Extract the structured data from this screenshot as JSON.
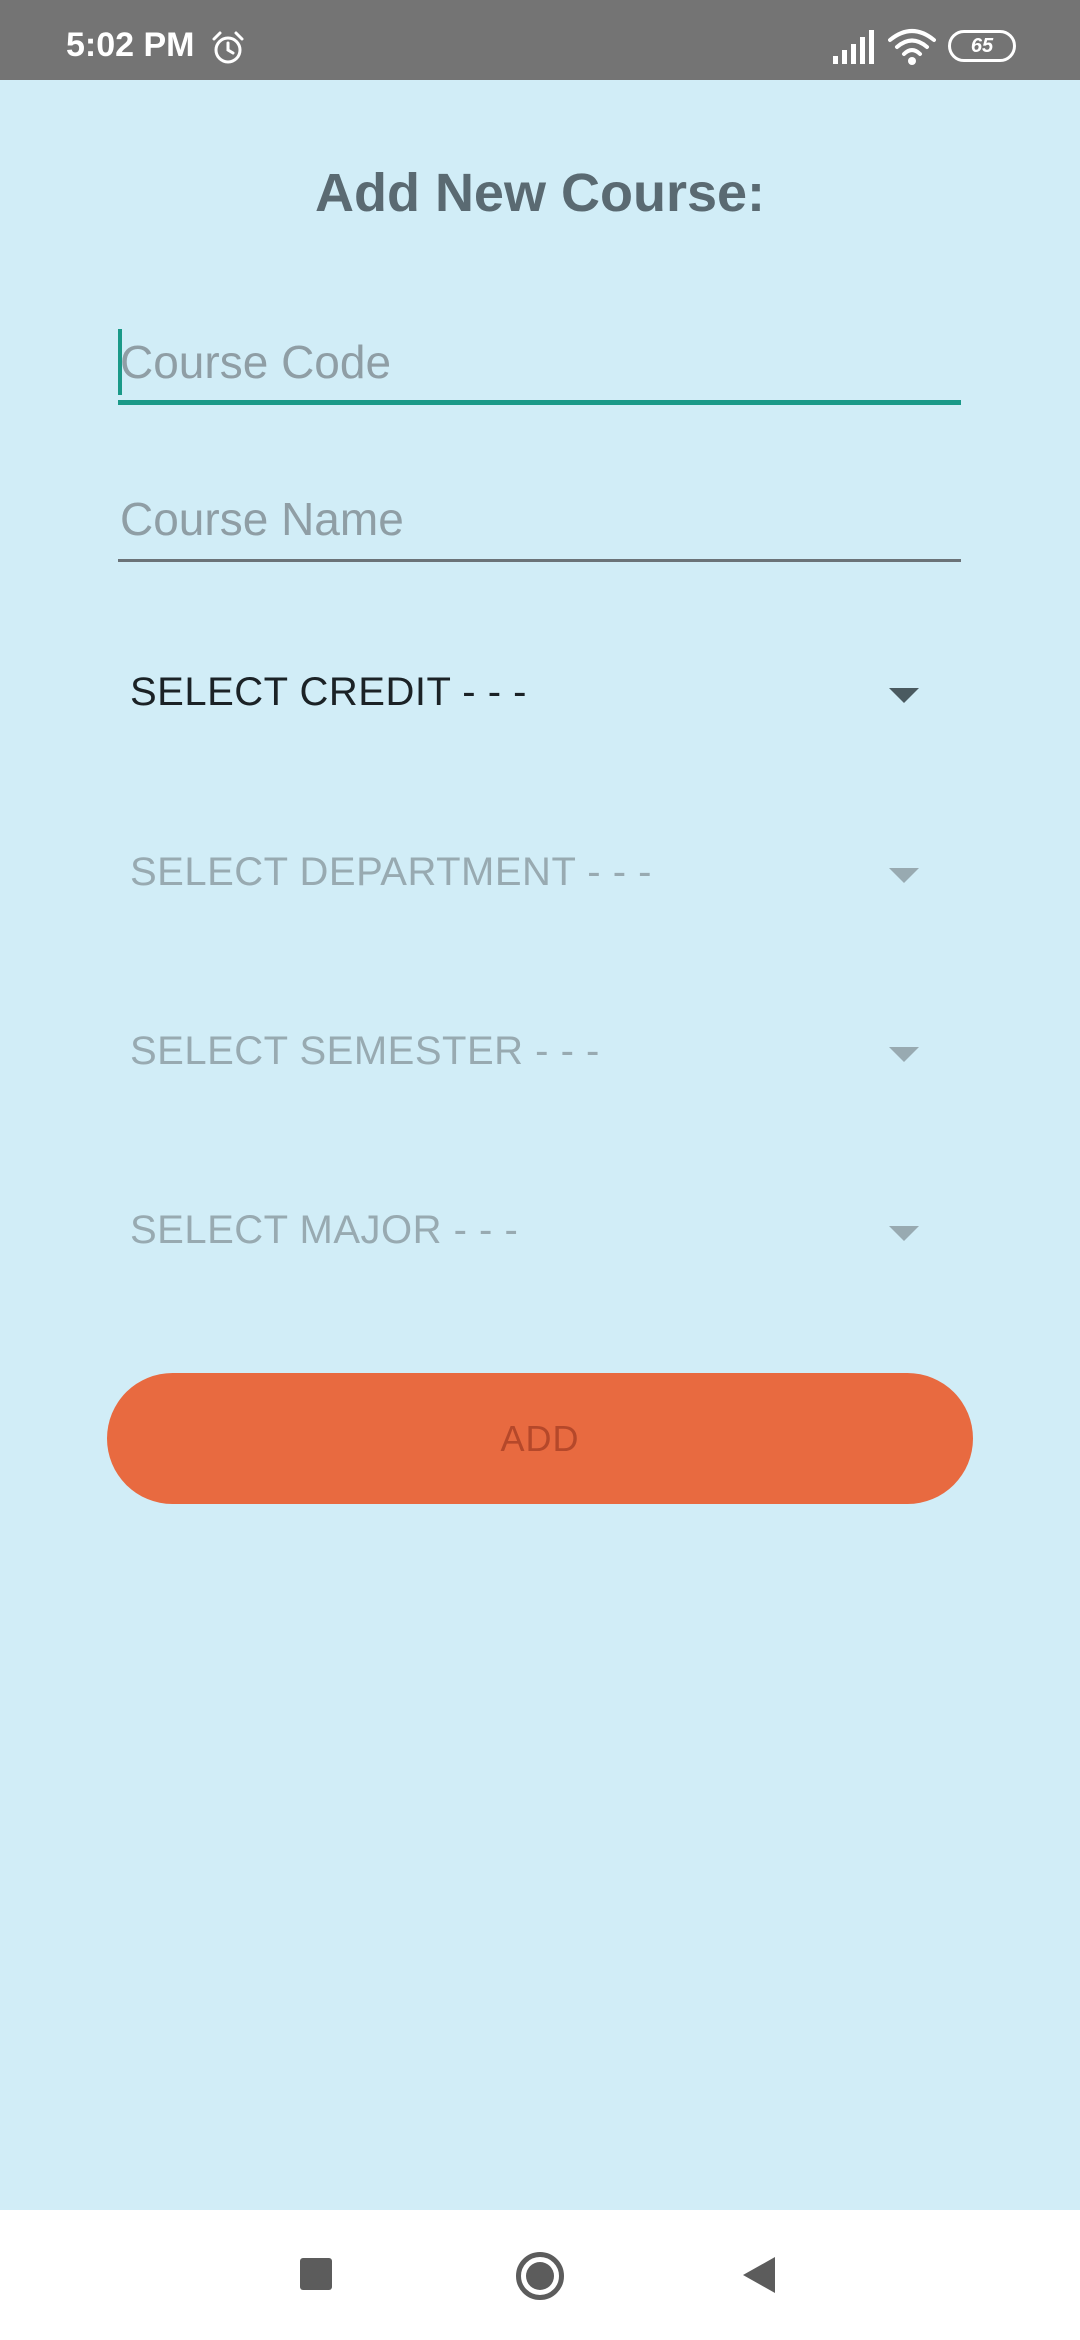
{
  "status_bar": {
    "time": "5:02 PM",
    "battery": "65",
    "icons": [
      "alarm-icon",
      "signal-icon",
      "wifi-icon",
      "battery-icon"
    ]
  },
  "page": {
    "title": "Add New Course:"
  },
  "form": {
    "course_code": {
      "placeholder": "Course Code",
      "value": ""
    },
    "course_name": {
      "placeholder": "Course Name",
      "value": ""
    },
    "credit": {
      "label": "SELECT CREDIT  - - -",
      "enabled": true
    },
    "department": {
      "label": "SELECT DEPARTMENT  - - -",
      "enabled": false
    },
    "semester": {
      "label": "SELECT SEMESTER  - - -",
      "enabled": false
    },
    "major": {
      "label": "SELECT MAJOR  - - -",
      "enabled": false
    },
    "add_button": {
      "label": "ADD"
    }
  },
  "colors": {
    "background": "#d1edf7",
    "accent": "#1a9988",
    "button": "#e86a40",
    "button_text": "#b5482a",
    "status_bar": "#747474"
  },
  "nav_bar": {
    "buttons": [
      "recent-apps-icon",
      "home-icon",
      "back-icon"
    ]
  }
}
